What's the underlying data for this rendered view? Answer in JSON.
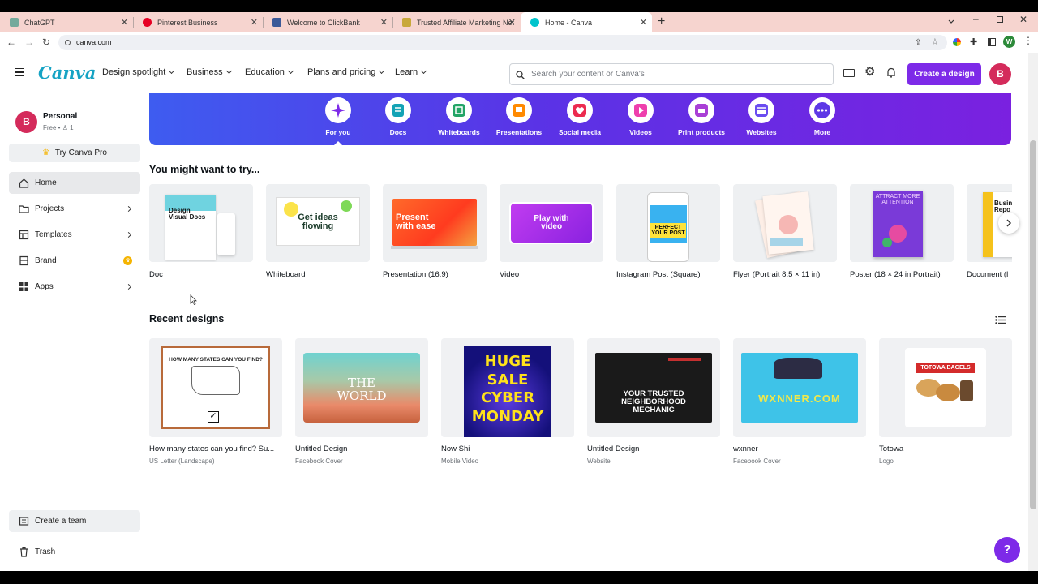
{
  "browser": {
    "tabs": [
      {
        "title": "ChatGPT",
        "favicon_color": "#74aa9c"
      },
      {
        "title": "Pinterest Business",
        "favicon_color": "#e60023"
      },
      {
        "title": "Welcome to ClickBank",
        "favicon_color": "#3b5998"
      },
      {
        "title": "Trusted Affiliate Marketing Netw",
        "favicon_color": "#c8a83a"
      },
      {
        "title": "Home - Canva",
        "favicon_color": "#00c4cc"
      }
    ],
    "new_tab": "+",
    "url": "canva.com",
    "profile_initial": "W"
  },
  "header": {
    "logo": "Canva",
    "nav": [
      "Design spotlight",
      "Business",
      "Education",
      "Plans and pricing",
      "Learn"
    ],
    "search_placeholder": "Search your content or Canva's",
    "create_button": "Create a design",
    "avatar_initial": "B"
  },
  "sidebar": {
    "account_initial": "B",
    "account_name": "Personal",
    "account_plan": "Free •",
    "account_members": "1",
    "try_pro": "Try Canva Pro",
    "items": [
      {
        "label": "Home",
        "icon": "home-icon",
        "active": true
      },
      {
        "label": "Projects",
        "icon": "folder-icon"
      },
      {
        "label": "Templates",
        "icon": "templates-icon"
      },
      {
        "label": "Brand",
        "icon": "brand-icon"
      },
      {
        "label": "Apps",
        "icon": "apps-icon"
      }
    ],
    "create_team": "Create a team",
    "trash": "Trash"
  },
  "categories": [
    {
      "label": "For you",
      "color": "#7d2ae8",
      "icon": "sparkle-icon"
    },
    {
      "label": "Docs",
      "color": "#13a3b5",
      "icon": "doc-icon"
    },
    {
      "label": "Whiteboards",
      "color": "#23a566",
      "icon": "whiteboard-icon"
    },
    {
      "label": "Presentations",
      "color": "#ff8a00",
      "icon": "presentation-icon"
    },
    {
      "label": "Social media",
      "color": "#ec2b4f",
      "icon": "heart-icon"
    },
    {
      "label": "Videos",
      "color": "#ee3fad",
      "icon": "video-icon"
    },
    {
      "label": "Print products",
      "color": "#a93fd6",
      "icon": "print-icon"
    },
    {
      "label": "Websites",
      "color": "#6a4cf0",
      "icon": "website-icon"
    },
    {
      "label": "More",
      "color": "#5d38e6",
      "icon": "more-icon"
    }
  ],
  "try_section": {
    "title": "You might want to try...",
    "templates": [
      {
        "label": "Doc",
        "thumb_text": "Design Visual Docs"
      },
      {
        "label": "Whiteboard",
        "thumb_text": "Get ideas flowing"
      },
      {
        "label": "Presentation (16:9)",
        "thumb_text": "Present with ease"
      },
      {
        "label": "Video",
        "thumb_text": "Play with video"
      },
      {
        "label": "Instagram Post (Square)",
        "thumb_text": "PERFECT YOUR POST"
      },
      {
        "label": "Flyer (Portrait 8.5 × 11 in)",
        "thumb_text": ""
      },
      {
        "label": "Poster (18 × 24 in Portrait)",
        "thumb_text": "ATTRACT MORE ATTENTION"
      },
      {
        "label": "Document (l",
        "thumb_text": "Busine Repo"
      }
    ]
  },
  "recent_section": {
    "title": "Recent designs",
    "designs": [
      {
        "name": "How many states can you find? Su...",
        "type": "US Letter (Landscape)",
        "thumb_text": "HOW MANY STATES CAN YOU FIND?"
      },
      {
        "name": "Untitled Design",
        "type": "Facebook Cover",
        "thumb_text": "THE WORLD"
      },
      {
        "name": "Now Shi",
        "type": "Mobile Video",
        "thumb_text": "HUGE SALE CYBER MONDAY"
      },
      {
        "name": "Untitled Design",
        "type": "Website",
        "thumb_text": "YOUR TRUSTED NEIGHBORHOOD MECHANIC"
      },
      {
        "name": "wxnner",
        "type": "Facebook Cover",
        "thumb_text": "WXNNER.COM"
      },
      {
        "name": "Totowa",
        "type": "Logo",
        "thumb_text": "TOTOWA BAGELS"
      }
    ]
  },
  "help_label": "?"
}
